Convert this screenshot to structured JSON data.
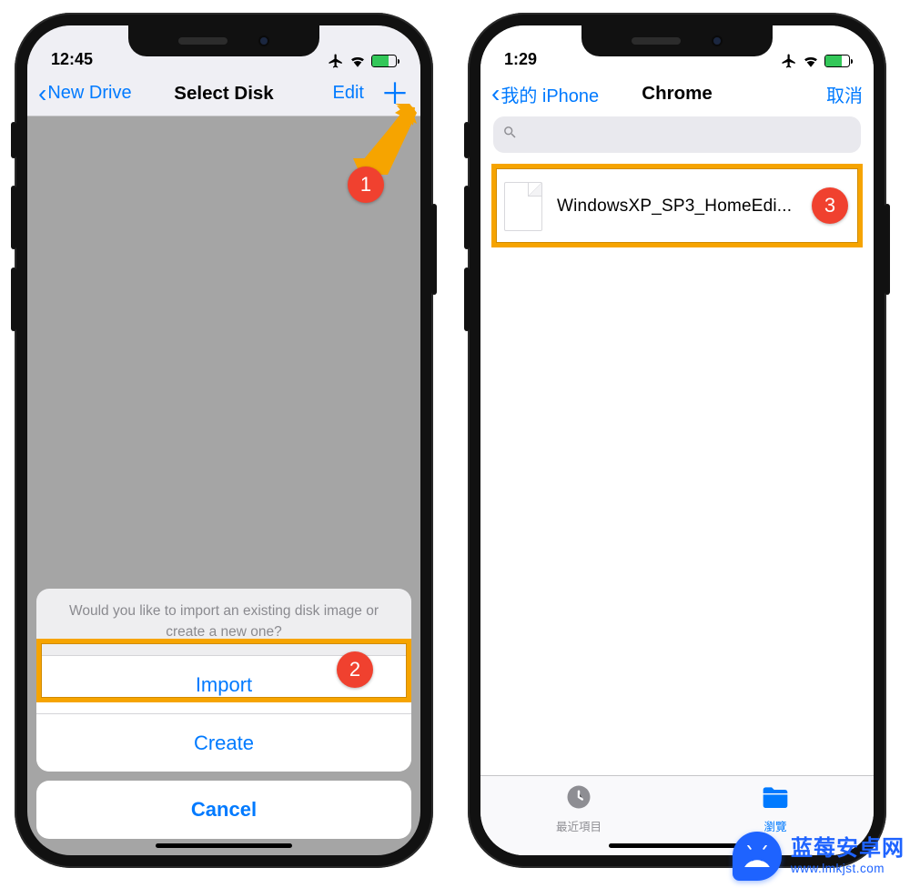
{
  "left": {
    "status": {
      "time": "12:45"
    },
    "nav": {
      "back": "New Drive",
      "title": "Select Disk",
      "edit": "Edit"
    },
    "sheet": {
      "message": "Would you like to import an existing disk image or create a new one?",
      "import": "Import",
      "create": "Create",
      "cancel": "Cancel"
    },
    "badges": {
      "b1": "1",
      "b2": "2"
    }
  },
  "right": {
    "status": {
      "time": "1:29"
    },
    "nav": {
      "back": "我的 iPhone",
      "title": "Chrome",
      "cancel": "取消"
    },
    "file": {
      "name": "WindowsXP_SP3_HomeEdi..."
    },
    "tabs": {
      "recent": "最近項目",
      "browse": "瀏覽"
    },
    "badges": {
      "b3": "3"
    }
  },
  "watermark": {
    "title": "蓝莓安卓网",
    "url": "www.lmkjst.com"
  }
}
